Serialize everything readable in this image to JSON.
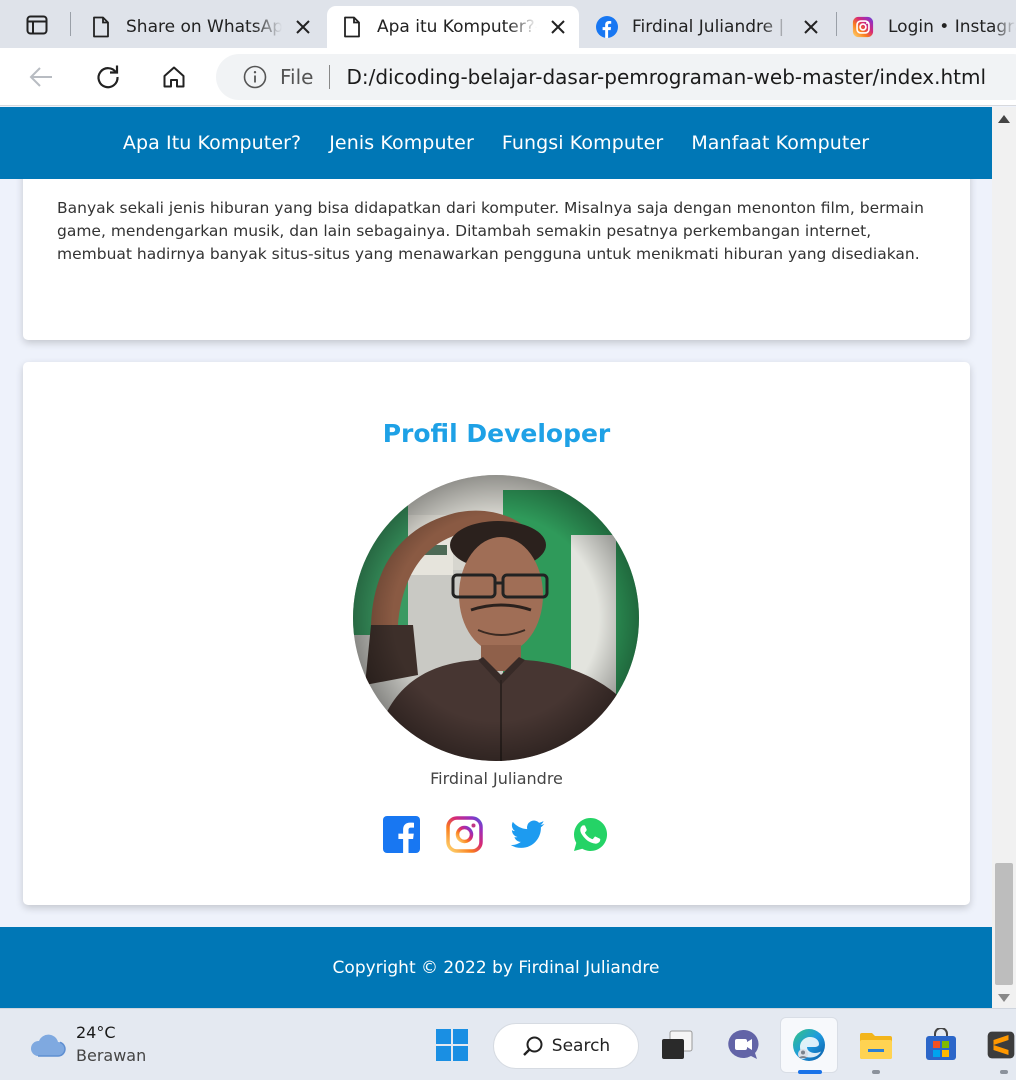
{
  "browser": {
    "tabs": [
      {
        "title": "Share on WhatsApp",
        "icon": "page-icon",
        "active": false
      },
      {
        "title": "Apa itu Komputer?-",
        "icon": "page-icon",
        "active": true
      },
      {
        "title": "Firdinal Juliandre | F",
        "icon": "facebook-icon",
        "active": false
      },
      {
        "title": "Login • Instagra",
        "icon": "instagram-icon",
        "active": false
      }
    ],
    "address": {
      "scheme": "File",
      "url": "D:/dicoding-belajar-dasar-pemrograman-web-master/index.html"
    }
  },
  "site": {
    "nav": [
      "Apa Itu Komputer?",
      "Jenis Komputer",
      "Fungsi Komputer",
      "Manfaat Komputer"
    ],
    "entertainment_text": "Banyak sekali jenis hiburan yang bisa didapatkan dari komputer. Misalnya saja dengan menonton film, bermain game, mendengarkan musik, dan lain sebagainya. Ditambah semakin pesatnya perkembangan internet, membuat hadirnya banyak situs-situs yang menawarkan pengguna untuk menikmati hiburan yang disediakan.",
    "profile": {
      "title": "Profil Developer",
      "name": "Firdinal Juliandre",
      "socials": [
        "facebook-icon",
        "instagram-icon",
        "twitter-icon",
        "whatsapp-icon"
      ]
    },
    "footer": "Copyright © 2022 by Firdinal Juliandre",
    "colors": {
      "primary": "#0077b6",
      "accent": "#1ea1e6"
    }
  },
  "taskbar": {
    "weather": {
      "temp": "24°C",
      "condition": "Berawan",
      "icon": "cloud-icon"
    },
    "search_label": "Search",
    "apps": [
      "windows-start-icon",
      "search",
      "task-view-icon",
      "teams-chat-icon",
      "edge-icon",
      "file-explorer-icon",
      "store-icon",
      "sublime-icon"
    ]
  }
}
